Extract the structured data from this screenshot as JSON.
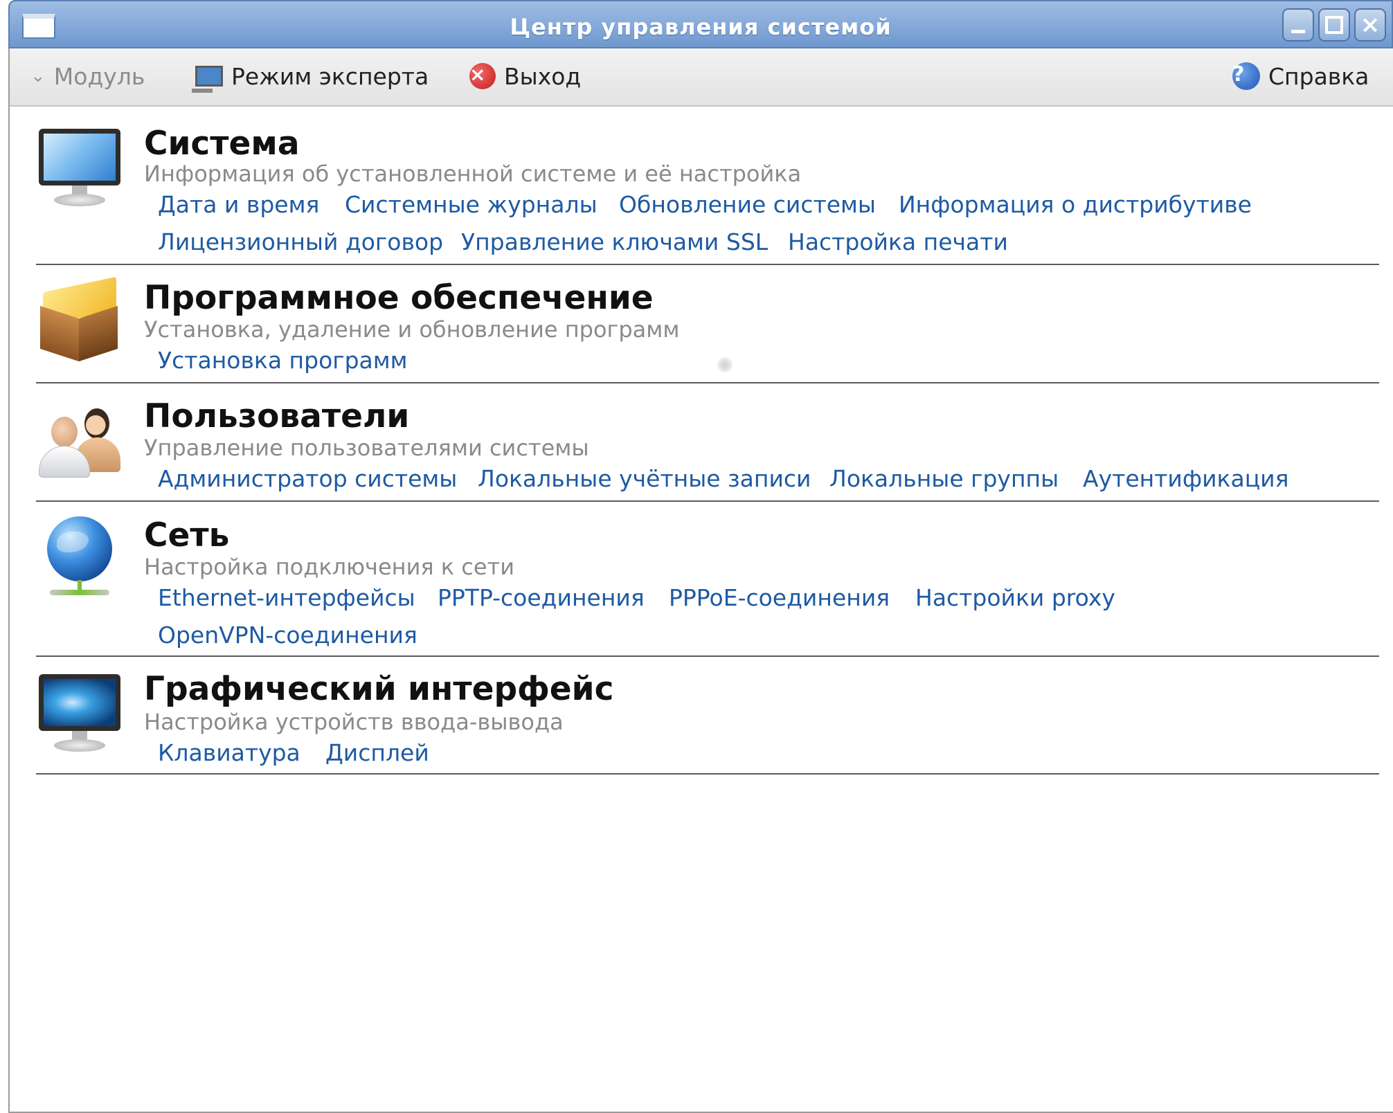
{
  "window": {
    "title": "Центр управления системой"
  },
  "toolbar": {
    "module_label": "Модуль",
    "expert_label": "Режим эксперта",
    "exit_label": "Выход",
    "help_label": "Справка"
  },
  "sections": [
    {
      "title": "Система",
      "description": "Информация об установленной системе и её настройка",
      "icon": "monitor-icon",
      "links": [
        "Дата и время",
        "Системные журналы",
        "Обновление системы",
        "Информация о дистрибутиве",
        "Лицензионный договор",
        "Управление ключами SSL",
        "Настройка печати"
      ]
    },
    {
      "title": "Программное обеспечение",
      "description": "Установка, удаление и обновление программ",
      "icon": "package-icon",
      "links": [
        "Установка программ"
      ]
    },
    {
      "title": "Пользователи",
      "description": "Управление пользователями системы",
      "icon": "users-icon",
      "links": [
        "Администратор системы",
        "Локальные учётные записи",
        "Локальные группы",
        "Аутентификация"
      ]
    },
    {
      "title": "Сеть",
      "description": "Настройка подключения к сети",
      "icon": "globe-network-icon",
      "links": [
        "Ethernet-интерфейсы",
        "PPTP-соединения",
        "PPPoE-соединения",
        "Настройки proxy",
        "OpenVPN-соединения"
      ]
    },
    {
      "title": "Графический интерфейс",
      "description": "Настройка устройств ввода-вывода",
      "icon": "display-icon",
      "links": [
        "Клавиатура",
        "Дисплей"
      ]
    }
  ],
  "colors": {
    "titlebar": "#7fa6d8",
    "link": "#1e5aa3",
    "description": "#8a8a8a",
    "separator": "#5a5a5a"
  }
}
